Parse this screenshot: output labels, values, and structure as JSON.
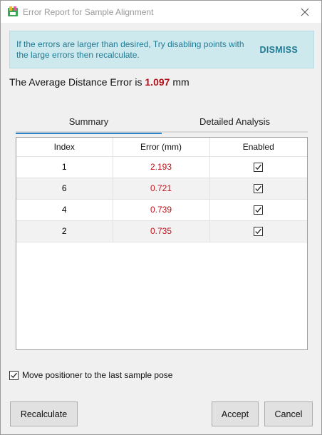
{
  "window": {
    "title": "Error Report for Sample Alignment",
    "icon": "app-icon",
    "close_icon": "close-icon"
  },
  "banner": {
    "message": "If the errors are larger than desired, Try disabling points with the large errors then recalculate.",
    "dismiss_label": "DISMISS"
  },
  "average": {
    "prefix": "The Average Distance Error is",
    "value": "1.097",
    "unit": "mm"
  },
  "tabs": [
    {
      "label": "Summary",
      "active": true
    },
    {
      "label": "Detailed Analysis",
      "active": false
    }
  ],
  "table": {
    "headers": [
      "Index",
      "Error (mm)",
      "Enabled"
    ],
    "rows": [
      {
        "index": "1",
        "error": "2.193",
        "enabled": true
      },
      {
        "index": "6",
        "error": "0.721",
        "enabled": true
      },
      {
        "index": "4",
        "error": "0.739",
        "enabled": true
      },
      {
        "index": "2",
        "error": "0.735",
        "enabled": true
      }
    ]
  },
  "move_positioner": {
    "label": "Move positioner to the last sample pose",
    "checked": true
  },
  "buttons": {
    "recalculate": "Recalculate",
    "accept": "Accept",
    "cancel": "Cancel"
  },
  "colors": {
    "accent": "#2e82c6",
    "banner_bg": "#cde9ee",
    "banner_text": "#1f7b95",
    "error_text": "#c0121c"
  }
}
